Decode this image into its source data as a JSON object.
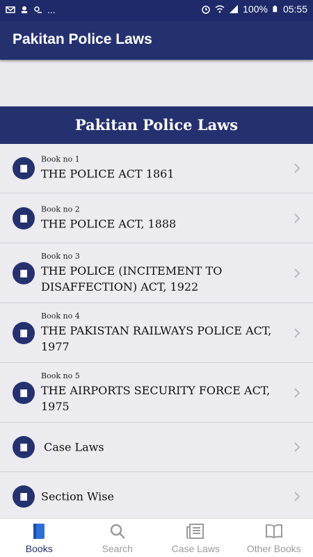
{
  "status_bar": {
    "left_dots": "...",
    "battery": "100%",
    "time": "05:55"
  },
  "app_bar": {
    "title": "Pakitan Police Laws"
  },
  "section": {
    "title": "Pakitan Police Laws"
  },
  "items": [
    {
      "sub": "Book no 1",
      "title": "THE POLICE ACT 1861"
    },
    {
      "sub": "Book no 2",
      "title": "THE POLICE ACT, 1888"
    },
    {
      "sub": "Book no 3",
      "title": "THE POLICE (INCITEMENT TO DISAFFECTION) ACT, 1922"
    },
    {
      "sub": "Book no 4",
      "title": "THE PAKISTAN RAILWAYS POLICE ACT, 1977"
    },
    {
      "sub": "Book no 5",
      "title": "THE AIRPORTS SECURITY FORCE ACT, 1975"
    },
    {
      "sub": "",
      "title": "Case Laws"
    },
    {
      "sub": "",
      "title": "Section Wise"
    }
  ],
  "bottom_nav": [
    {
      "label": "Books",
      "icon": "book-icon"
    },
    {
      "label": "Search",
      "icon": "search-icon"
    },
    {
      "label": "Case Laws",
      "icon": "newspaper-icon"
    },
    {
      "label": "Other Books",
      "icon": "open-book-icon"
    }
  ],
  "colors": {
    "primary": "#25316f",
    "background": "#ebebf0",
    "inactive": "#9a9a9a"
  }
}
